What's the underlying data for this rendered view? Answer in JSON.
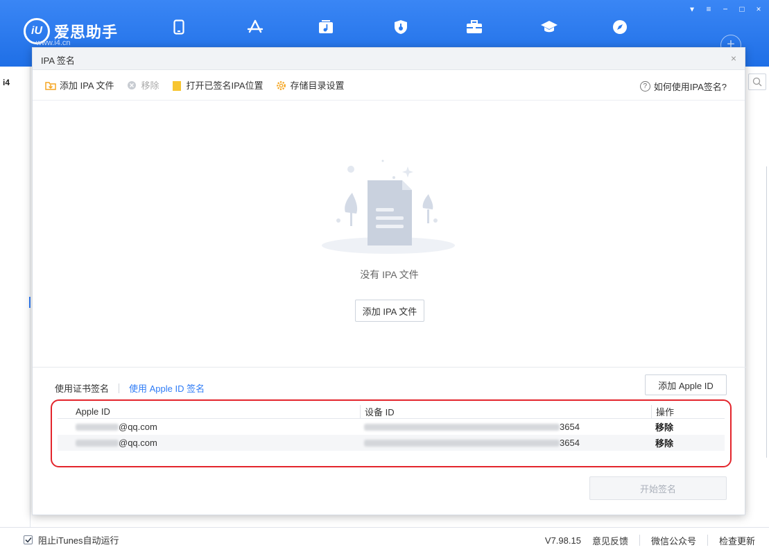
{
  "app": {
    "brand_name": "爱思助手",
    "brand_url": "www.i4.cn"
  },
  "nav_icons": [
    "phone-icon",
    "app-store-icon",
    "music-icon",
    "shield-icon",
    "toolbox-icon",
    "graduation-cap-icon",
    "compass-icon"
  ],
  "background": {
    "left_label": "i4"
  },
  "dialog": {
    "title": "IPA 签名",
    "close": "×",
    "toolbar": {
      "add_ipa": "添加 IPA 文件",
      "remove": "移除",
      "open_signed_location": "打开已签名IPA位置",
      "storage_settings": "存储目录设置",
      "help": "如何使用IPA签名?"
    },
    "empty": {
      "text": "没有 IPA 文件",
      "button": "添加 IPA 文件"
    },
    "sign_tabs": {
      "certificate": "使用证书签名",
      "apple_id": "使用 Apple ID 签名"
    },
    "add_apple_id": "添加 Apple ID",
    "table": {
      "headers": [
        "Apple ID",
        "设备 ID",
        "操作"
      ],
      "rows": [
        {
          "apple_id_suffix": "@qq.com",
          "device_id_suffix": "3654",
          "action": "移除"
        },
        {
          "apple_id_suffix": "@qq.com",
          "device_id_suffix": "3654",
          "action": "移除"
        }
      ]
    },
    "start_sign": "开始签名"
  },
  "status_bar": {
    "checkbox_label": "阻止iTunes自动运行",
    "checkbox_checked": true,
    "version": "V7.98.15",
    "feedback": "意见反馈",
    "wechat": "微信公众号",
    "check_update": "检查更新"
  },
  "colors": {
    "header_blue": "#1f6fe6",
    "link_blue": "#2f7cf6",
    "highlight_red": "#e3242b",
    "folder_orange": "#f5a623"
  }
}
